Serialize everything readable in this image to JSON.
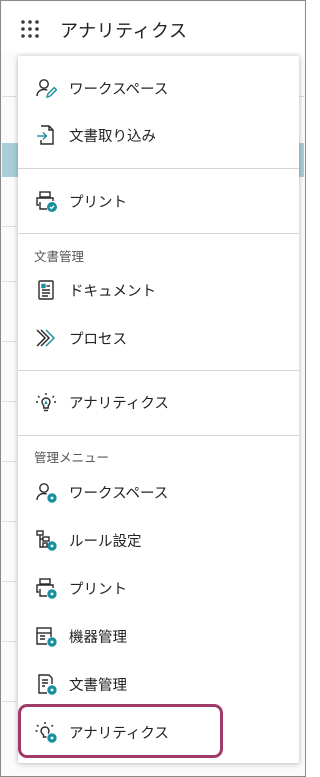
{
  "app": {
    "title": "アナリティクス"
  },
  "icons": {
    "waffle": "app-launcher-grid-icon",
    "accent_color": "#1a8fa0",
    "highlight_color": "#a03a68"
  },
  "menu": {
    "items": [
      {
        "label": "ワークスペース",
        "icon": "user-edit-icon"
      },
      {
        "label": "文書取り込み",
        "icon": "document-import-icon"
      },
      {
        "label": "プリント",
        "icon": "printer-check-icon"
      }
    ],
    "doc_section": {
      "heading": "文書管理",
      "items": [
        {
          "label": "ドキュメント",
          "icon": "document-list-icon"
        },
        {
          "label": "プロセス",
          "icon": "process-chevrons-icon"
        }
      ]
    },
    "analytics_item": {
      "label": "アナリティクス",
      "icon": "lightbulb-icon"
    },
    "admin_section": {
      "heading": "管理メニュー",
      "items": [
        {
          "label": "ワークスペース",
          "icon": "user-settings-icon"
        },
        {
          "label": "ルール設定",
          "icon": "rule-hierarchy-settings-icon"
        },
        {
          "label": "プリント",
          "icon": "printer-settings-icon"
        },
        {
          "label": "機器管理",
          "icon": "device-settings-icon"
        },
        {
          "label": "文書管理",
          "icon": "document-settings-icon"
        },
        {
          "label": "アナリティクス",
          "icon": "lightbulb-settings-icon"
        }
      ]
    }
  }
}
